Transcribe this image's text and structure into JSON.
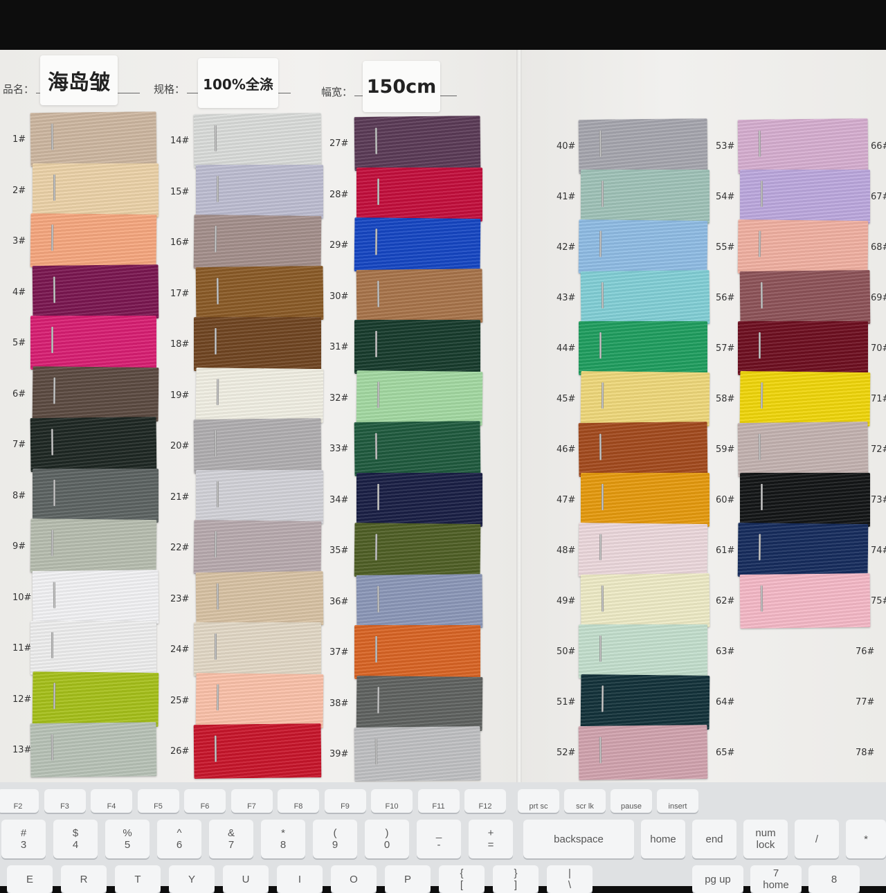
{
  "header": {
    "name_label": "品名：",
    "name_value": "海岛皱",
    "spec_label": "规格：",
    "spec_value": "100%全涤",
    "width_label": "幅宽：",
    "width_value": "150cm"
  },
  "swatches": [
    {
      "n": "1#",
      "c": "#cdb7a0"
    },
    {
      "n": "2#",
      "c": "#ecd2a8"
    },
    {
      "n": "3#",
      "c": "#f6a77e"
    },
    {
      "n": "4#",
      "c": "#7a1650"
    },
    {
      "n": "5#",
      "c": "#d81e72"
    },
    {
      "n": "6#",
      "c": "#5b4a41"
    },
    {
      "n": "7#",
      "c": "#1e2723"
    },
    {
      "n": "8#",
      "c": "#5c6362"
    },
    {
      "n": "9#",
      "c": "#b7bdaf"
    },
    {
      "n": "10#",
      "c": "#f2f2f4"
    },
    {
      "n": "11#",
      "c": "#eeeeee"
    },
    {
      "n": "12#",
      "c": "#a6c01a"
    },
    {
      "n": "13#",
      "c": "#b8c2b7"
    },
    {
      "n": "14#",
      "c": "#dadcda"
    },
    {
      "n": "15#",
      "c": "#bdbdd1"
    },
    {
      "n": "16#",
      "c": "#a48f8b"
    },
    {
      "n": "17#",
      "c": "#8a5a26"
    },
    {
      "n": "18#",
      "c": "#704521"
    },
    {
      "n": "19#",
      "c": "#f1efe3"
    },
    {
      "n": "20#",
      "c": "#b0aeb0"
    },
    {
      "n": "21#",
      "c": "#d2d2d8"
    },
    {
      "n": "22#",
      "c": "#b8aaae"
    },
    {
      "n": "23#",
      "c": "#d8c2a4"
    },
    {
      "n": "24#",
      "c": "#e2d8c6"
    },
    {
      "n": "25#",
      "c": "#fbc1a9"
    },
    {
      "n": "26#",
      "c": "#c8152b"
    },
    {
      "n": "27#",
      "c": "#5a3a56"
    },
    {
      "n": "28#",
      "c": "#c30e3c"
    },
    {
      "n": "29#",
      "c": "#1546c3"
    },
    {
      "n": "30#",
      "c": "#a8744a"
    },
    {
      "n": "31#",
      "c": "#173b2c"
    },
    {
      "n": "32#",
      "c": "#a3d9a2"
    },
    {
      "n": "33#",
      "c": "#1f5a3e"
    },
    {
      "n": "34#",
      "c": "#1a1f45"
    },
    {
      "n": "35#",
      "c": "#4f5f25"
    },
    {
      "n": "36#",
      "c": "#8b97b8"
    },
    {
      "n": "37#",
      "c": "#d96424"
    },
    {
      "n": "38#",
      "c": "#5f6260"
    },
    {
      "n": "39#",
      "c": "#bfc0c2"
    },
    {
      "n": "40#",
      "c": "#a6a6ae"
    },
    {
      "n": "41#",
      "c": "#9fc2b8"
    },
    {
      "n": "42#",
      "c": "#8fbce4"
    },
    {
      "n": "43#",
      "c": "#82cfd6"
    },
    {
      "n": "44#",
      "c": "#1f9e5f"
    },
    {
      "n": "45#",
      "c": "#efd87a"
    },
    {
      "n": "46#",
      "c": "#a34a1d"
    },
    {
      "n": "47#",
      "c": "#e69a0d"
    },
    {
      "n": "48#",
      "c": "#ecd8dc"
    },
    {
      "n": "49#",
      "c": "#eeebc6"
    },
    {
      "n": "50#",
      "c": "#c3dfcd"
    },
    {
      "n": "51#",
      "c": "#13323a"
    },
    {
      "n": "52#",
      "c": "#d1a3ae"
    },
    {
      "n": "53#",
      "c": "#d6aed0"
    },
    {
      "n": "54#",
      "c": "#bca8de"
    },
    {
      "n": "55#",
      "c": "#f1b0a1"
    },
    {
      "n": "56#",
      "c": "#8d5358"
    },
    {
      "n": "57#",
      "c": "#6e0f20"
    },
    {
      "n": "58#",
      "c": "#f0d60a"
    },
    {
      "n": "59#",
      "c": "#c3b2b0"
    },
    {
      "n": "60#",
      "c": "#131516"
    },
    {
      "n": "61#",
      "c": "#162c5e"
    },
    {
      "n": "62#",
      "c": "#f5b9c7"
    },
    {
      "n": "63#",
      "c": ""
    },
    {
      "n": "64#",
      "c": ""
    },
    {
      "n": "65#",
      "c": ""
    }
  ],
  "extra_numbers": [
    "66#",
    "67#",
    "68#",
    "69#",
    "70#",
    "71#",
    "72#",
    "73#",
    "74#",
    "75#",
    "76#",
    "77#",
    "78#"
  ],
  "keyboard": {
    "fn_keys": [
      "F2",
      "F3",
      "F4",
      "F5",
      "F6",
      "F7",
      "F8",
      "F9",
      "F10",
      "F11",
      "F12",
      "prt sc",
      "scr lk",
      "pause",
      "insert"
    ],
    "num_keys": [
      "#\n3",
      "$\n4",
      "%\n5",
      "^\n6",
      "&\n7",
      "*\n8",
      "(\n9",
      ")\n0",
      "_\n-",
      "+\n=",
      "backspace",
      "home",
      "end",
      "num\nlock",
      "/",
      "*"
    ],
    "bottom_keys": [
      "E",
      "R",
      "T",
      "Y",
      "U",
      "I",
      "O",
      "P",
      "{\n[",
      "}\n]",
      "|\n\\",
      "pg up",
      "7\nhome",
      "8"
    ]
  }
}
